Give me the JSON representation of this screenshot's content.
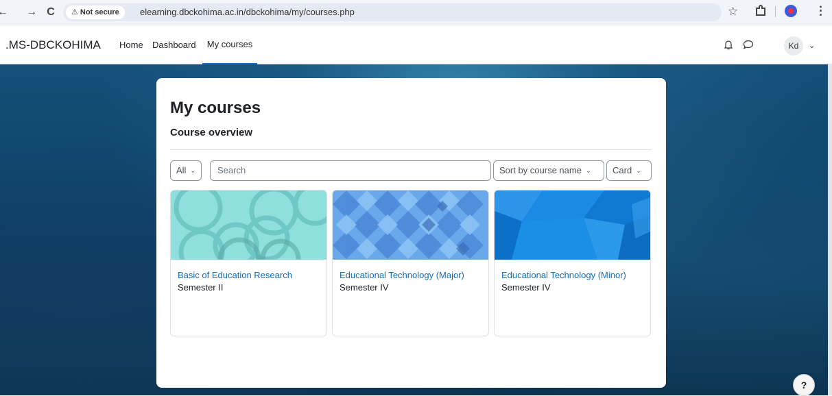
{
  "browser": {
    "back": "←",
    "forward": "→",
    "reload": "C",
    "security_warning": "⚠",
    "security_label": "Not secure",
    "url": "elearning.dbckohima.ac.in/dbckohima/my/courses.php",
    "star": "☆",
    "menu": "⋮"
  },
  "navbar": {
    "site_name": ".MS-DBCKOHIMA",
    "links": [
      {
        "label": "Home",
        "active": false
      },
      {
        "label": "Dashboard",
        "active": false
      },
      {
        "label": "My courses",
        "active": true
      }
    ],
    "user_initials": "Kd",
    "caret": "⌄"
  },
  "page": {
    "title": "My courses",
    "section_title": "Course overview"
  },
  "filters": {
    "grouping": "All",
    "search_placeholder": "Search",
    "sort": "Sort by course name",
    "view": "Card",
    "chevron": "⌄"
  },
  "courses": [
    {
      "name": "Basic of Education Research",
      "category": "Semester II",
      "pattern": "circles",
      "color": "#8fe0dc"
    },
    {
      "name": "Educational Technology (Major)",
      "category": "Semester IV",
      "pattern": "diamonds",
      "color": "#6aa8ec"
    },
    {
      "name": "Educational Technology (Minor)",
      "category": "Semester IV",
      "pattern": "polygons",
      "color": "#1485e0"
    }
  ],
  "help": {
    "label": "?"
  },
  "colors": {
    "accent": "#0f6cbf",
    "link": "#0f6cbf",
    "background": "#12486e"
  }
}
